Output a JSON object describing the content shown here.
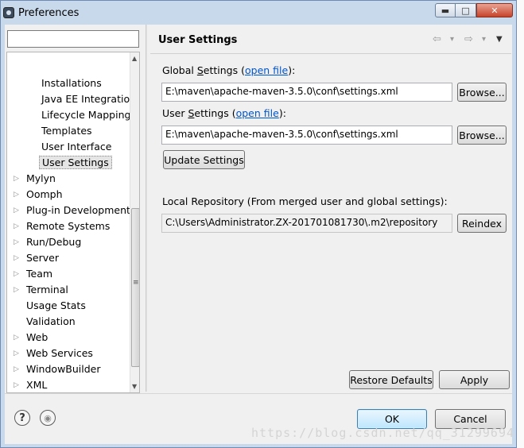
{
  "window": {
    "title": "Preferences",
    "minimize_glyph": "▬",
    "maximize_glyph": "□",
    "close_glyph": "✕"
  },
  "filter": {
    "value": ""
  },
  "tree": {
    "items": [
      {
        "label": "Installations",
        "level": 2,
        "expandable": false,
        "selected": false
      },
      {
        "label": "Java EE Integration",
        "level": 2,
        "expandable": false,
        "selected": false
      },
      {
        "label": "Lifecycle Mapping",
        "level": 2,
        "expandable": false,
        "selected": false
      },
      {
        "label": "Templates",
        "level": 2,
        "expandable": false,
        "selected": false
      },
      {
        "label": "User Interface",
        "level": 2,
        "expandable": false,
        "selected": false
      },
      {
        "label": "User Settings",
        "level": 2,
        "expandable": false,
        "selected": true
      },
      {
        "label": "Mylyn",
        "level": 1,
        "expandable": true,
        "selected": false
      },
      {
        "label": "Oomph",
        "level": 1,
        "expandable": true,
        "selected": false
      },
      {
        "label": "Plug-in Development",
        "level": 1,
        "expandable": true,
        "selected": false
      },
      {
        "label": "Remote Systems",
        "level": 1,
        "expandable": true,
        "selected": false
      },
      {
        "label": "Run/Debug",
        "level": 1,
        "expandable": true,
        "selected": false
      },
      {
        "label": "Server",
        "level": 1,
        "expandable": true,
        "selected": false
      },
      {
        "label": "Team",
        "level": 1,
        "expandable": true,
        "selected": false
      },
      {
        "label": "Terminal",
        "level": 1,
        "expandable": true,
        "selected": false
      },
      {
        "label": "Usage Stats",
        "level": 1,
        "expandable": false,
        "selected": false
      },
      {
        "label": "Validation",
        "level": 1,
        "expandable": false,
        "selected": false
      },
      {
        "label": "Web",
        "level": 1,
        "expandable": true,
        "selected": false
      },
      {
        "label": "Web Services",
        "level": 1,
        "expandable": true,
        "selected": false
      },
      {
        "label": "WindowBuilder",
        "level": 1,
        "expandable": true,
        "selected": false
      },
      {
        "label": "XML",
        "level": 1,
        "expandable": true,
        "selected": false
      }
    ]
  },
  "page": {
    "title": "User Settings",
    "nav_icons": {
      "back": "⇦",
      "back_menu": "▾",
      "forward": "⇨",
      "forward_menu": "▾",
      "view_menu": "▼"
    },
    "global": {
      "label_prefix": "Global ",
      "label_mnemonic": "S",
      "label_rest": "ettings (",
      "link": "open file",
      "label_suffix": "):",
      "value": "E:\\maven\\apache-maven-3.5.0\\conf\\settings.xml",
      "browse": "Browse..."
    },
    "user": {
      "label_prefix": "User ",
      "label_mnemonic": "S",
      "label_rest": "ettings (",
      "link": "open file",
      "label_suffix": "):",
      "value": "E:\\maven\\apache-maven-3.5.0\\conf\\settings.xml",
      "browse": "Browse..."
    },
    "update_button": "Update Settings",
    "local_repo": {
      "label": "Local Repository (From merged user and global settings):",
      "value": "C:\\Users\\Administrator.ZX-201701081730\\.m2\\repository",
      "reindex": "Reindex"
    },
    "restore_defaults": "Restore Defaults",
    "apply": "Apply"
  },
  "footer": {
    "help_glyph": "?",
    "import_glyph": "◉",
    "ok": "OK",
    "cancel": "Cancel"
  },
  "watermark": "https://blog.csdn.net/qq_31299694",
  "colors": {
    "link": "#0055cc",
    "primary_border": "#3c7fb1",
    "frame": "#c9d9ec"
  }
}
